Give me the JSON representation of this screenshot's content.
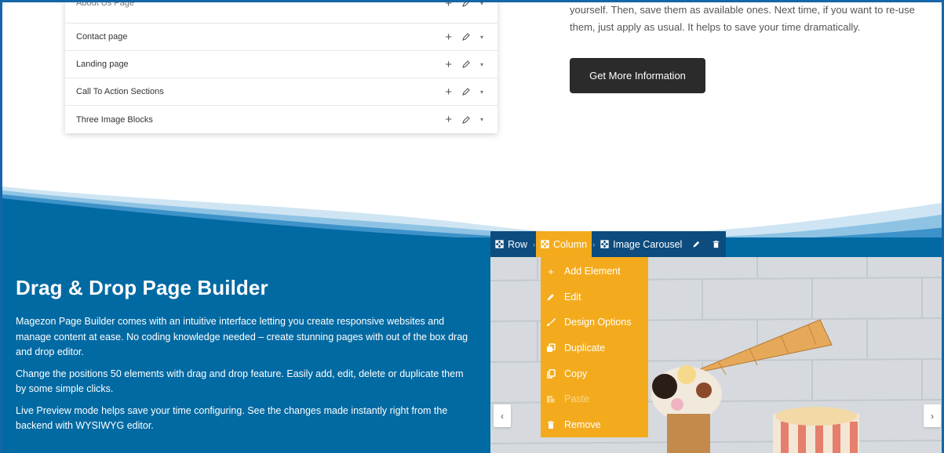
{
  "template_list": {
    "rows": [
      {
        "label": "About Us Page"
      },
      {
        "label": "Contact page"
      },
      {
        "label": "Landing page"
      },
      {
        "label": "Call To Action Sections"
      },
      {
        "label": "Three Image Blocks"
      }
    ],
    "icons": {
      "add": "plus-icon",
      "edit": "pencil-icon",
      "more": "caret-down-icon"
    }
  },
  "right_panel": {
    "line1": "yourself. Then, save them as available ones. Next time, if you want to re-use",
    "line2": "them, just apply as usual. It helps to save your time dramatically.",
    "button": "Get More Information"
  },
  "hero": {
    "title": "Drag & Drop Page Builder",
    "paragraphs": [
      "Magezon Page Builder comes with an intuitive interface letting you create responsive websites and manage content at ease. No coding knowledge needed – create stunning pages with out of the box drag and drop editor.",
      "Change the positions 50 elements with drag and drop feature. Easily add, edit, delete or duplicate them by some simple clicks.",
      "Live Preview mode helps save your time configuring. See the changes made instantly right from the backend with WYSIWYG editor."
    ]
  },
  "editor_toolbar": {
    "row": "Row",
    "column": "Column",
    "element": "Image Carousel",
    "sep": "›"
  },
  "column_menu": {
    "items": [
      {
        "label": "Add Element",
        "icon": "plus-icon"
      },
      {
        "label": "Edit",
        "icon": "pencil-icon"
      },
      {
        "label": "Design Options",
        "icon": "brush-icon"
      },
      {
        "label": "Duplicate",
        "icon": "duplicate-icon"
      },
      {
        "label": "Copy",
        "icon": "copy-icon"
      },
      {
        "label": "Paste",
        "icon": "paste-icon",
        "disabled": true
      },
      {
        "label": "Remove",
        "icon": "trash-icon"
      }
    ]
  },
  "carousel": {
    "prev": "‹",
    "next": "›"
  },
  "colors": {
    "frame": "#1565a8",
    "section_blue": "#016aa3",
    "toolbar": "#0d4c7e",
    "accent": "#f3ab1d",
    "button_dark": "#2b2b2b"
  }
}
